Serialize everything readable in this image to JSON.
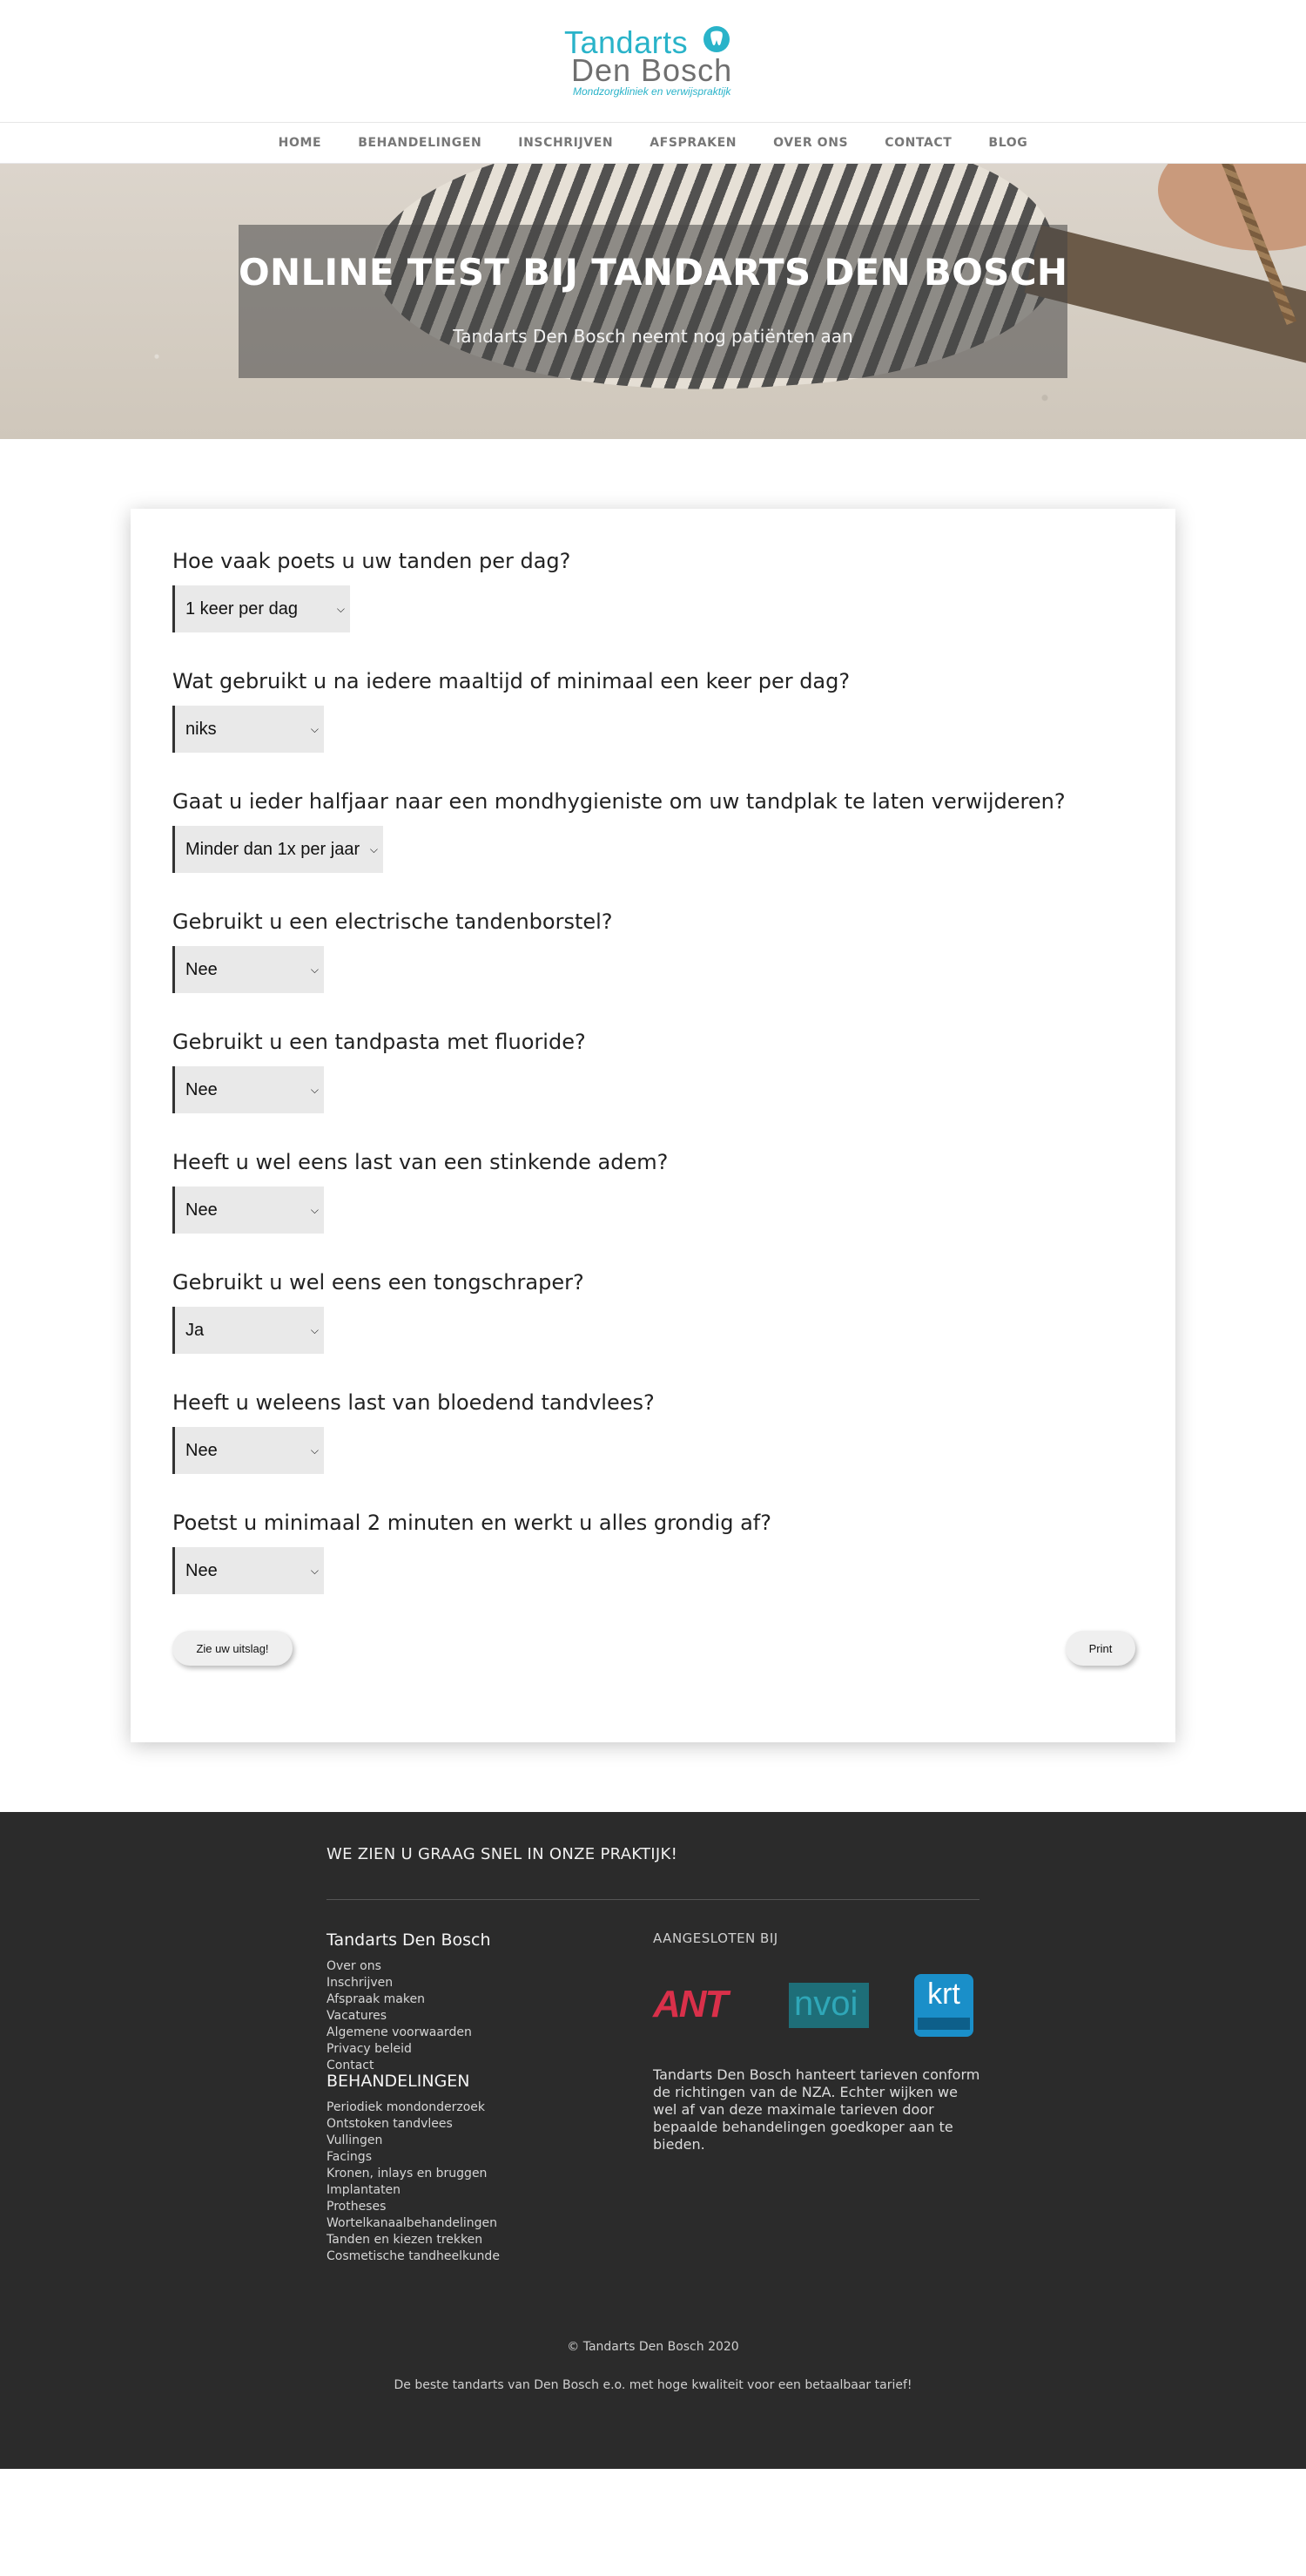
{
  "logo": {
    "line1": "Tandarts",
    "line2": "Den Bosch",
    "tagline": "Mondzorgkliniek en verwijspraktijk",
    "colors": {
      "accent": "#29b3c9",
      "secondary": "#6f6f6f"
    }
  },
  "nav": {
    "items": [
      "HOME",
      "BEHANDELINGEN",
      "INSCHRIJVEN",
      "AFSPRAKEN",
      "OVER ONS",
      "CONTACT",
      "BLOG"
    ]
  },
  "hero": {
    "title": "ONLINE TEST BIJ TANDARTS DEN BOSCH",
    "subtitle": "Tandarts Den Bosch neemt nog patiënten aan"
  },
  "quiz": {
    "questions": [
      {
        "label": "Hoe vaak poets u uw tanden per dag?",
        "selected": "1 keer per dag"
      },
      {
        "label": "Wat gebruikt u na iedere maaltijd of minimaal een keer per dag?",
        "selected": "niks"
      },
      {
        "label": "Gaat u ieder halfjaar naar een mondhygieniste om uw tandplak te laten verwijderen?",
        "selected": "Minder dan 1x per jaar"
      },
      {
        "label": "Gebruikt u een electrische tandenborstel?",
        "selected": "Nee"
      },
      {
        "label": "Gebruikt u een tandpasta met fluoride?",
        "selected": "Nee"
      },
      {
        "label": "Heeft u wel eens last van een stinkende adem?",
        "selected": "Nee"
      },
      {
        "label": "Gebruikt u wel eens een tongschraper?",
        "selected": "Ja"
      },
      {
        "label": "Heeft u weleens last van bloedend tandvlees?",
        "selected": "Nee"
      },
      {
        "label": "Poetst u minimaal 2 minuten en werkt u alles grondig af?",
        "selected": "Nee"
      }
    ],
    "result_button": "Zie uw uitslag!",
    "print_button": "Print"
  },
  "footer": {
    "tagline": "WE ZIEN U GRAAG SNEL IN ONZE PRAKTIJK!",
    "col1_title": "Tandarts Den Bosch",
    "col1_links": [
      "Over ons",
      "Inschrijven",
      "Afspraak maken",
      "Vacatures",
      "Algemene voorwaarden",
      "Privacy beleid",
      "Contact"
    ],
    "col2_title": "BEHANDELINGEN",
    "col2_links": [
      "Periodiek mondonderzoek",
      "Ontstoken tandvlees",
      "Vullingen",
      "Facings",
      "Kronen, inlays en bruggen",
      "Implantaten",
      "Protheses",
      "Wortelkanaalbehandelingen",
      "Tanden en kiezen trekken",
      "Cosmetische tandheelkunde"
    ],
    "aangesloten": "AANGESLOTEN BIJ",
    "logos": {
      "ant": "ANT",
      "nvoi": "nvoi",
      "krt": "krt"
    },
    "tarief_text": "Tandarts Den Bosch hanteert tarieven conform de richtingen van de NZA. Echter wijken we wel af van deze maximale tarieven door bepaalde behandelingen goedkoper aan te bieden.",
    "copyright": "© Tandarts Den Bosch 2020",
    "slogan": "De beste tandarts van Den Bosch e.o. met hoge kwaliteit voor een betaalbaar tarief!"
  }
}
